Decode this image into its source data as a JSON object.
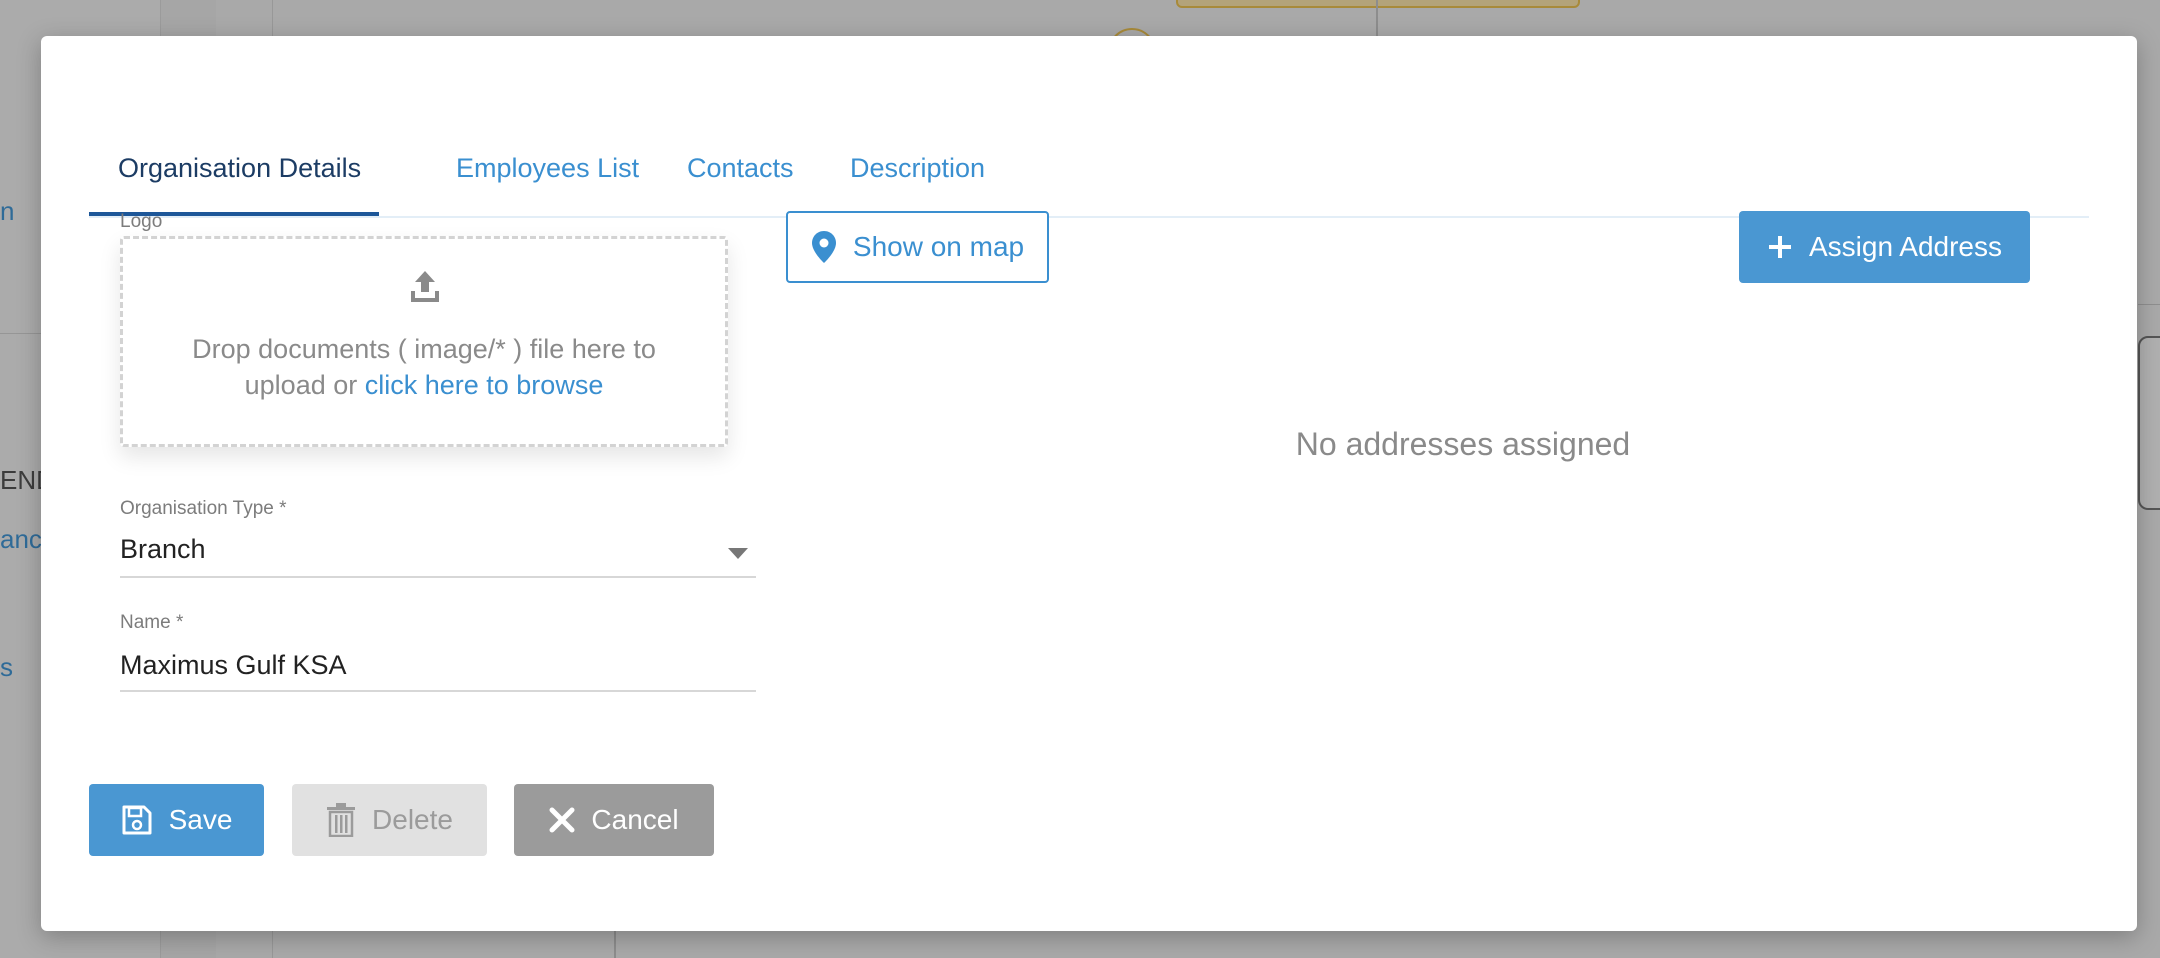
{
  "background": {
    "fragments": [
      "n",
      "END",
      "ance",
      "s"
    ]
  },
  "tabs": [
    {
      "label": "Organisation Details",
      "active": true
    },
    {
      "label": "Employees List",
      "active": false
    },
    {
      "label": "Contacts",
      "active": false
    },
    {
      "label": "Description",
      "active": false
    }
  ],
  "logo": {
    "label": "Logo",
    "drop_text_line1": "Drop documents ( image/* ) file here to",
    "drop_text_line2_prefix": "upload or ",
    "browse_link": "click here to browse"
  },
  "organisation_type": {
    "label": "Organisation Type *",
    "value": "Branch"
  },
  "name_field": {
    "label": "Name *",
    "value": "Maximus Gulf KSA"
  },
  "address": {
    "show_on_map_label": "Show on map",
    "assign_address_label": "Assign Address",
    "empty_message": "No addresses assigned"
  },
  "actions": {
    "save_label": "Save",
    "delete_label": "Delete",
    "cancel_label": "Cancel"
  },
  "colors": {
    "accent": "#4a97d2",
    "link": "#3a8fd0",
    "active_tab": "#1c3c64"
  }
}
